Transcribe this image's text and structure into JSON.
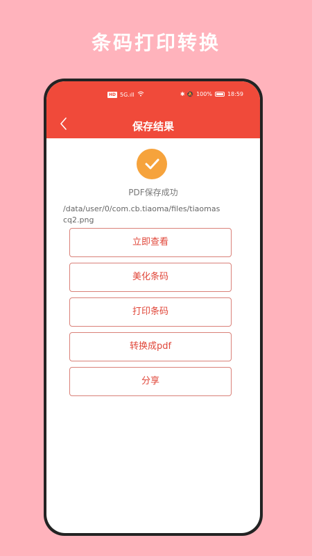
{
  "promo": {
    "title": "条码打印转换"
  },
  "statusbar": {
    "badge": "HD",
    "signal": "5G.ıll",
    "right_icons": "✱ 🔕",
    "battery": "100%",
    "time": "18:59"
  },
  "navbar": {
    "title": "保存结果"
  },
  "result": {
    "success_text": "PDF保存成功",
    "file_path": "/data/user/0/com.cb.tiaoma/files/tiaomascq2.png"
  },
  "actions": {
    "view": "立即查看",
    "beautify": "美化条码",
    "print": "打印条码",
    "convert": "转换成pdf",
    "share": "分享"
  },
  "colors": {
    "background": "#FFB3BC",
    "primary": "#F04A3A",
    "success": "#F6A33C",
    "button_text": "#E0473A"
  }
}
